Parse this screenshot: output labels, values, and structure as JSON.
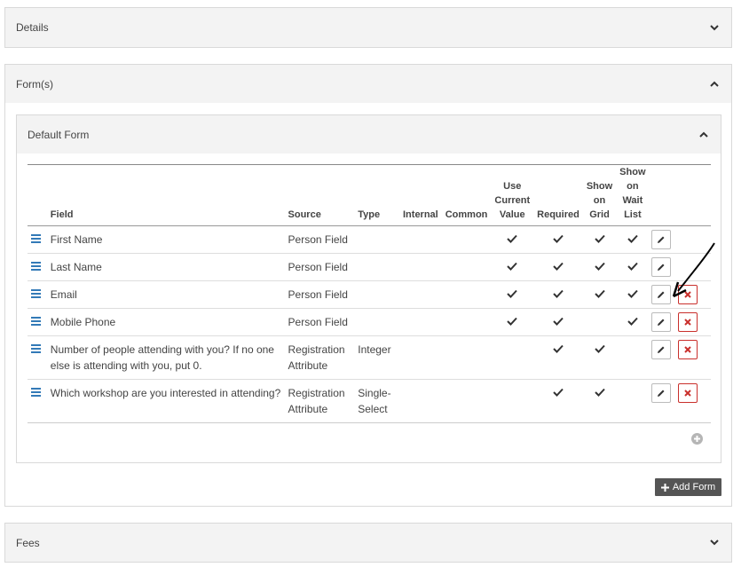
{
  "panels": {
    "details": {
      "title": "Details"
    },
    "forms": {
      "title": "Form(s)"
    },
    "fees": {
      "title": "Fees"
    }
  },
  "default_form": {
    "title": "Default Form"
  },
  "table": {
    "headers": {
      "field": "Field",
      "source": "Source",
      "type": "Type",
      "internal": "Internal",
      "common": "Common",
      "use_current_value": [
        "Use",
        "Current",
        "Value"
      ],
      "required": "Required",
      "show_on_grid": [
        "Show",
        "on",
        "Grid"
      ],
      "show_on_wait_list": [
        "Show",
        "on",
        "Wait",
        "List"
      ]
    },
    "rows": [
      {
        "field": "First Name",
        "source": "Person Field",
        "type": "",
        "use_current": true,
        "required": true,
        "grid": true,
        "wait": true,
        "deletable": false
      },
      {
        "field": "Last Name",
        "source": "Person Field",
        "type": "",
        "use_current": true,
        "required": true,
        "grid": true,
        "wait": true,
        "deletable": false
      },
      {
        "field": "Email",
        "source": "Person Field",
        "type": "",
        "use_current": true,
        "required": true,
        "grid": true,
        "wait": true,
        "deletable": true
      },
      {
        "field": "Mobile Phone",
        "source": "Person Field",
        "type": "",
        "use_current": true,
        "required": true,
        "grid": false,
        "wait": true,
        "deletable": true
      },
      {
        "field": "Number of people attending with you? If no one else is attending with you, put 0.",
        "source": "Registration Attribute",
        "type": "Integer",
        "use_current": false,
        "required": true,
        "grid": true,
        "wait": false,
        "deletable": true
      },
      {
        "field": "Which workshop are you interested in attending?",
        "source": "Registration Attribute",
        "type": "Single-Select",
        "use_current": false,
        "required": true,
        "grid": true,
        "wait": false,
        "deletable": true
      }
    ]
  },
  "add_form_label": "Add Form",
  "icons": {
    "collapse": "chevron-up-icon",
    "expand": "chevron-down-icon",
    "drag": "reorder-icon",
    "edit": "pencil-icon",
    "delete": "close-icon",
    "add": "plus-circle-icon"
  },
  "colors": {
    "accent": "#337ab7",
    "danger": "#c9302c",
    "button_dark": "#555555"
  }
}
